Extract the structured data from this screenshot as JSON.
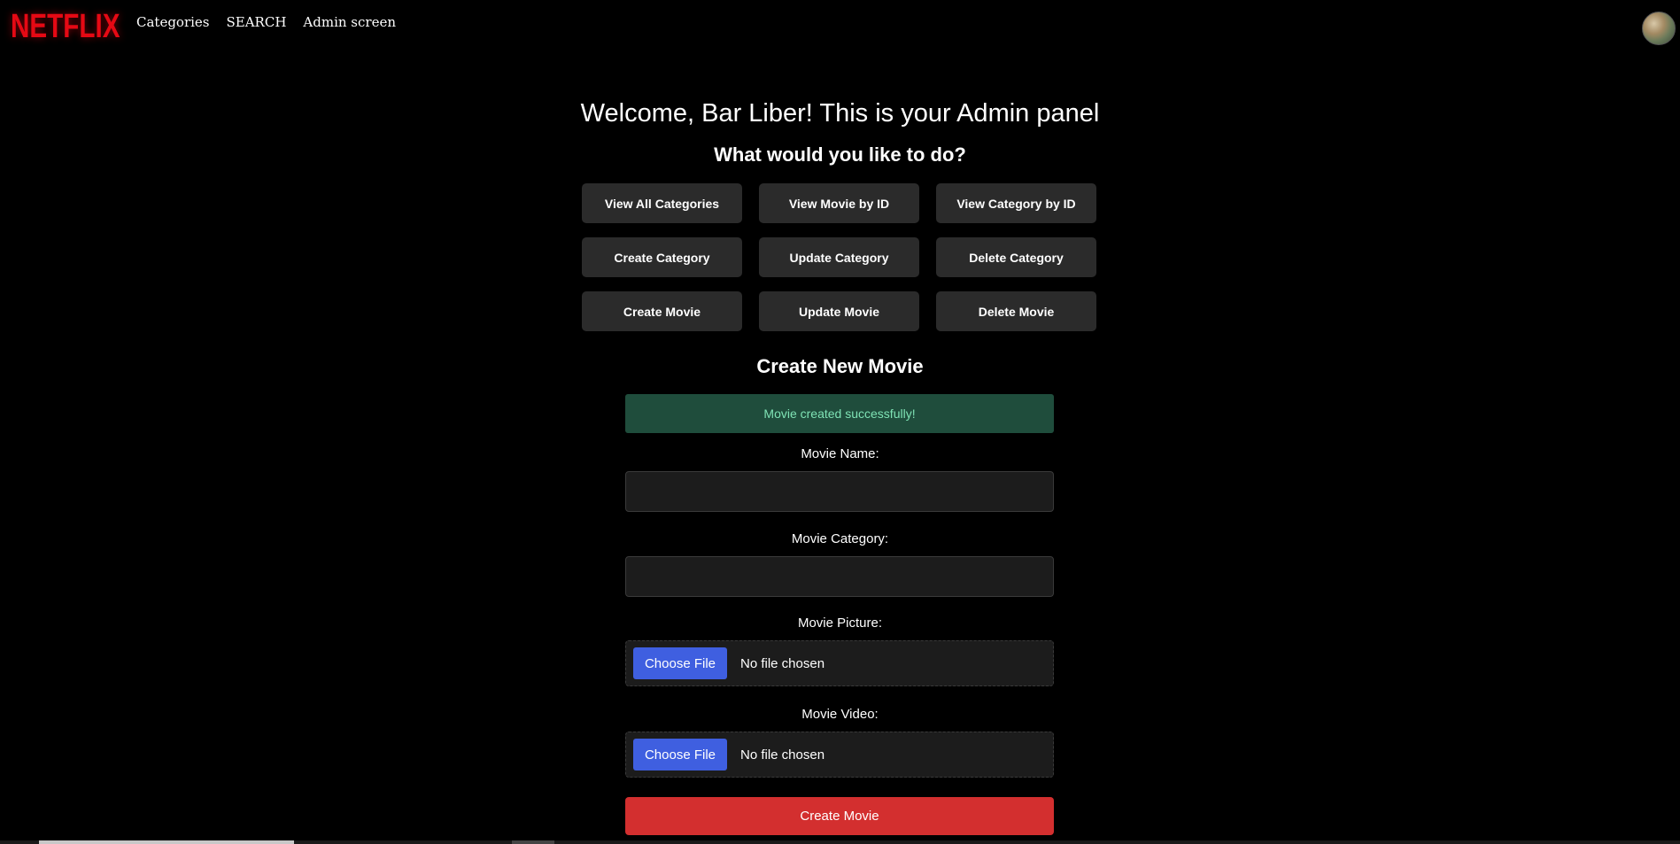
{
  "brand": {
    "logo_text": "NETFLIX",
    "logo_color": "#e50914"
  },
  "nav": {
    "links": [
      "Categories",
      "SEARCH",
      "Admin screen"
    ]
  },
  "user": {
    "avatar_icon": "user-avatar-photo"
  },
  "admin": {
    "welcome": "Welcome, Bar Liber! This is your Admin panel",
    "question": "What would you like to do?",
    "actions": [
      "View All Categories",
      "View Movie by ID",
      "View Category by ID",
      "Create Category",
      "Update Category",
      "Delete Category",
      "Create Movie",
      "Update Movie",
      "Delete Movie"
    ]
  },
  "form": {
    "title": "Create New Movie",
    "success_message": "Movie created successfully!",
    "name_label": "Movie Name:",
    "name_value": "",
    "category_label": "Movie Category:",
    "category_value": "",
    "picture_label": "Movie Picture:",
    "picture_button": "Choose File",
    "picture_status": "No file chosen",
    "video_label": "Movie Video:",
    "video_button": "Choose File",
    "video_status": "No file chosen",
    "submit_label": "Create Movie"
  },
  "colors": {
    "background": "#000000",
    "button_bg": "#2b2b2b",
    "success_bg": "#1f4d3c",
    "success_text": "#7fe3b5",
    "choose_file_bg": "#3f5fe0",
    "submit_bg": "#d32f2f"
  }
}
